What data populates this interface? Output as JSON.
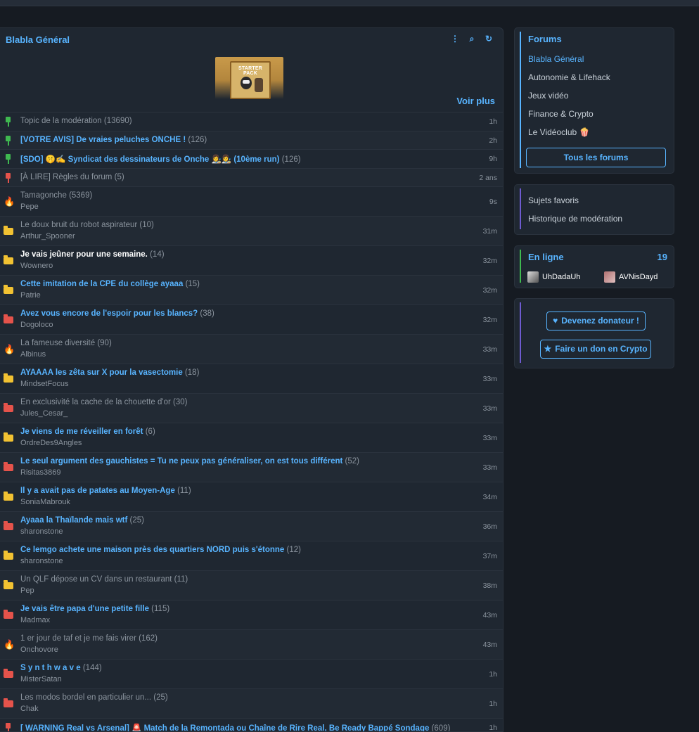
{
  "panel": {
    "title": "Blabla Général",
    "icons": [
      "more-icon",
      "search-icon",
      "refresh-icon"
    ],
    "banner_text": "STARTER PACK",
    "voir_plus": "Voir plus"
  },
  "topics": [
    {
      "type": "pin-g",
      "title": "Topic de la modération",
      "count": "(13690)",
      "author": "",
      "age": "1h",
      "style": "grey"
    },
    {
      "type": "pin-g",
      "title": "[VOTRE AVIS] De vraies peluches ONCHE !",
      "count": "(126)",
      "author": "",
      "age": "2h",
      "style": "blue"
    },
    {
      "type": "pin-g",
      "title": "[SDO] 🤫✍ Syndicat des dessinateurs de Onche 👩‍🎨👩‍🎨 (10ème run)",
      "count": "(126)",
      "author": "",
      "age": "9h",
      "style": "blue"
    },
    {
      "type": "pin-r",
      "title": "[À LIRE] Règles du forum",
      "count": "(5)",
      "author": "",
      "age": "2 ans",
      "style": "grey"
    },
    {
      "type": "flame",
      "title": "Tamagonche",
      "count": "(5369)",
      "author": "Pepe",
      "age": "9s",
      "style": "grey"
    },
    {
      "type": "folder-y",
      "title": "Le doux bruit du robot aspirateur",
      "count": "(10)",
      "author": "Arthur_Spooner",
      "age": "31m",
      "style": "grey"
    },
    {
      "type": "folder-y",
      "title": "Je vais jeûner pour une semaine.",
      "count": "(14)",
      "author": "Wownero",
      "age": "32m",
      "style": "white"
    },
    {
      "type": "folder-y",
      "title": "Cette imitation de la CPE du collège ayaaa",
      "count": "(15)",
      "author": "Patrie",
      "age": "32m",
      "style": "blue"
    },
    {
      "type": "folder-r",
      "title": "Avez vous encore de l'espoir pour les blancs?",
      "count": "(38)",
      "author": "Dogoloco",
      "age": "32m",
      "style": "blue"
    },
    {
      "type": "flame",
      "title": "La fameuse diversité",
      "count": "(90)",
      "author": "Albinus",
      "age": "33m",
      "style": "grey"
    },
    {
      "type": "folder-y",
      "title": "AYAAAA les zêta sur X pour la vasectomie",
      "count": "(18)",
      "author": "MindsetFocus",
      "age": "33m",
      "style": "blue"
    },
    {
      "type": "folder-r",
      "title": "En exclusivité la cache de la chouette d'or",
      "count": "(30)",
      "author": "Jules_Cesar_",
      "age": "33m",
      "style": "grey"
    },
    {
      "type": "folder-y",
      "title": "Je viens de me réveiller en forêt",
      "count": "(6)",
      "author": "OrdreDes9Angles",
      "age": "33m",
      "style": "blue"
    },
    {
      "type": "folder-r",
      "title": "Le seul argument des gauchistes = Tu ne peux pas généraliser, on est tous différent",
      "count": "(52)",
      "author": "Risitas3869",
      "age": "33m",
      "style": "blue"
    },
    {
      "type": "folder-y",
      "title": "Il y a avait pas de patates au Moyen-Age",
      "count": "(11)",
      "author": "SoniaMabrouk",
      "age": "34m",
      "style": "blue"
    },
    {
      "type": "folder-r",
      "title": "Ayaaa la Thaïlande mais wtf",
      "count": "(25)",
      "author": "sharonstone",
      "age": "36m",
      "style": "blue"
    },
    {
      "type": "folder-y",
      "title": "Ce lemgo achete une maison près des quartiers NORD puis s'étonne",
      "count": "(12)",
      "author": "sharonstone",
      "age": "37m",
      "style": "blue"
    },
    {
      "type": "folder-y",
      "title": "Un QLF dépose un CV dans un restaurant",
      "count": "(11)",
      "author": "Pep",
      "age": "38m",
      "style": "grey"
    },
    {
      "type": "folder-r",
      "title": "Je vais être papa d'une petite fille",
      "count": "(115)",
      "author": "Madmax",
      "age": "43m",
      "style": "blue"
    },
    {
      "type": "flame",
      "title": "1 er jour de taf et je me fais virer",
      "count": "(162)",
      "author": "Onchovore",
      "age": "43m",
      "style": "grey"
    },
    {
      "type": "folder-r",
      "title": "S y n t h w a v e",
      "count": "(144)",
      "author": "MisterSatan",
      "age": "1h",
      "style": "blue"
    },
    {
      "type": "folder-r",
      "title": "Les modos bordel en particulier un...",
      "count": "(25)",
      "author": "Chak",
      "age": "1h",
      "style": "grey"
    },
    {
      "type": "pin-r",
      "title": "[ WARNING Real vs Arsenal] 🚨 Match de la Remontada ou Chaîne de Rire Real, Be Ready Bappé Sondage",
      "count": "(609)",
      "author": "",
      "age": "1h",
      "style": "blue"
    }
  ],
  "sidebar": {
    "forums_title": "Forums",
    "forums": [
      "Blabla Général",
      "Autonomie & Lifehack",
      "Jeux vidéo",
      "Finance & Crypto",
      "Le Vidéoclub 🍿"
    ],
    "all_forums": "Tous les forums",
    "links": [
      "Sujets favoris",
      "Historique de modération"
    ],
    "online_title": "En ligne",
    "online_count": "19",
    "online_users": [
      "UhDadaUh",
      "AVNisDayd"
    ],
    "donate_button": "Devenez donateur !",
    "crypto_button": "Faire un don en Crypto"
  },
  "colors": {
    "accent": "#58b4ff",
    "bg": "#161b22",
    "panel": "#1f2731",
    "folder_yellow": "#f2c232",
    "folder_red": "#e5534b",
    "pin_green": "#3fb950"
  }
}
